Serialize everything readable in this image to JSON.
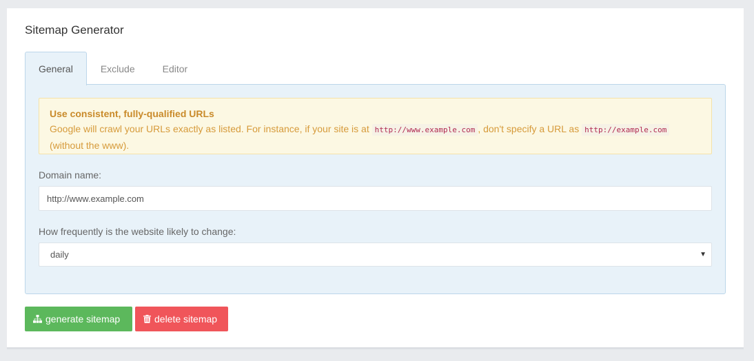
{
  "card": {
    "title": "Sitemap Generator"
  },
  "tabs": [
    {
      "label": "General",
      "active": true
    },
    {
      "label": "Exclude",
      "active": false
    },
    {
      "label": "Editor",
      "active": false
    }
  ],
  "alert": {
    "title": "Use consistent, fully-qualified URLs",
    "text_1": "Google will crawl your URLs exactly as listed. For instance, if your site is at ",
    "code_1": "http://www.example.com",
    "text_2": ", don't specify a URL as ",
    "code_2": "http://example.com",
    "text_3": "(without the www)."
  },
  "form": {
    "domain_label": "Domain name:",
    "domain_value": "http://www.example.com",
    "frequency_label": "How frequently is the website likely to change:",
    "frequency_value": "daily"
  },
  "buttons": {
    "generate_label": "generate sitemap",
    "generate_icon": "sitemap-icon",
    "delete_label": "delete sitemap",
    "delete_icon": "trash-icon"
  },
  "colors": {
    "generate": "#5cb85c",
    "delete": "#f0555a",
    "panel": "#e8f2f9",
    "alert_bg": "#fcf8e3"
  }
}
